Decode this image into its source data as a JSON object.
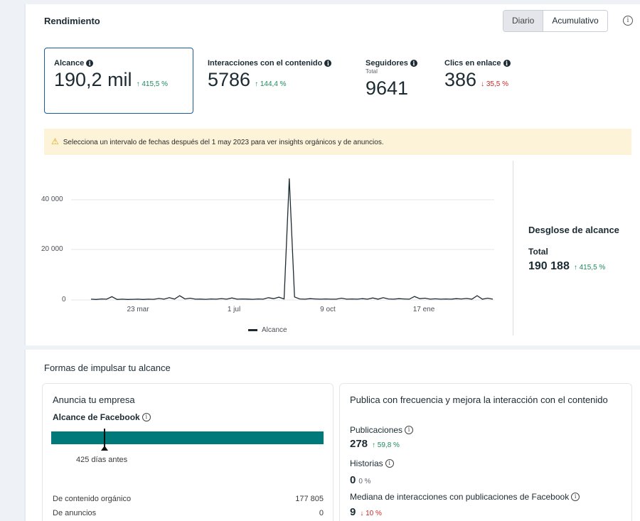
{
  "header": {
    "title": "Rendimiento",
    "toggle_daily": "Diario",
    "toggle_cumulative": "Acumulativo"
  },
  "metrics": [
    {
      "label": "Alcance",
      "value": "190,2 mil",
      "change": "↑ 415,5 %",
      "trend": "up"
    },
    {
      "label": "Interacciones con el contenido",
      "value": "5786",
      "change": "↑ 144,4 %",
      "trend": "up"
    },
    {
      "label": "Seguidores",
      "sub": "Total",
      "value": "9641"
    },
    {
      "label": "Clics en enlace",
      "value": "386",
      "change": "↓ 35,5 %",
      "trend": "down"
    }
  ],
  "alert": {
    "icon": "warning-icon",
    "text": "Selecciona un intervalo de fechas después del 1 may 2023 para ver insights orgánicos y de anuncios."
  },
  "chart_data": {
    "type": "line",
    "y_ticks": [
      "40 000",
      "20 000",
      "0"
    ],
    "x_ticks": [
      "23 mar",
      "1 jul",
      "9 oct",
      "17 ene"
    ],
    "ylim": [
      0,
      50000
    ],
    "series": [
      {
        "name": "Alcance",
        "values": [
          300,
          200,
          400,
          300,
          1300,
          200,
          300,
          200,
          250,
          300,
          200,
          300,
          250,
          600,
          300,
          900,
          350,
          1700,
          400,
          700,
          300,
          350,
          250,
          400,
          300,
          550,
          300,
          800,
          300,
          400,
          350,
          250,
          400,
          300,
          900,
          500,
          1100,
          400,
          48500,
          1200,
          400,
          300,
          500,
          400,
          300,
          400,
          300,
          300,
          700,
          300,
          400,
          300,
          500,
          300,
          800,
          300,
          900,
          400,
          300,
          500,
          400,
          300,
          1400,
          500,
          700,
          300,
          450,
          300,
          400,
          300,
          500,
          400,
          600,
          300,
          1700,
          300,
          700,
          300
        ]
      }
    ],
    "legend": "Alcance",
    "grid": true
  },
  "breakdown": {
    "title": "Desglose de alcance",
    "total_label": "Total",
    "total_value": "190 188",
    "change": "↑ 415,5 %"
  },
  "boost": {
    "title": "Formas de impulsar tu alcance",
    "ad_card": {
      "title": "Anuncia tu empresa",
      "fb_reach_label": "Alcance de Facebook",
      "marker_caption": "425 días antes",
      "rows": [
        {
          "label": "De contenido orgánico",
          "value": "177 805"
        },
        {
          "label": "De anuncios",
          "value": "0"
        }
      ]
    },
    "publish_card": {
      "title": "Publica con frecuencia y mejora la interacción con el contenido",
      "stats": [
        {
          "label": "Publicaciones",
          "value": "278",
          "change": "↑ 59,8 %",
          "trend": "up"
        },
        {
          "label": "Historias",
          "value": "0",
          "change": "0 %",
          "trend": "flat"
        },
        {
          "label": "Mediana de interacciones con publicaciones de Facebook",
          "value": "9",
          "change": "↓ 10 %",
          "trend": "down"
        }
      ]
    }
  }
}
